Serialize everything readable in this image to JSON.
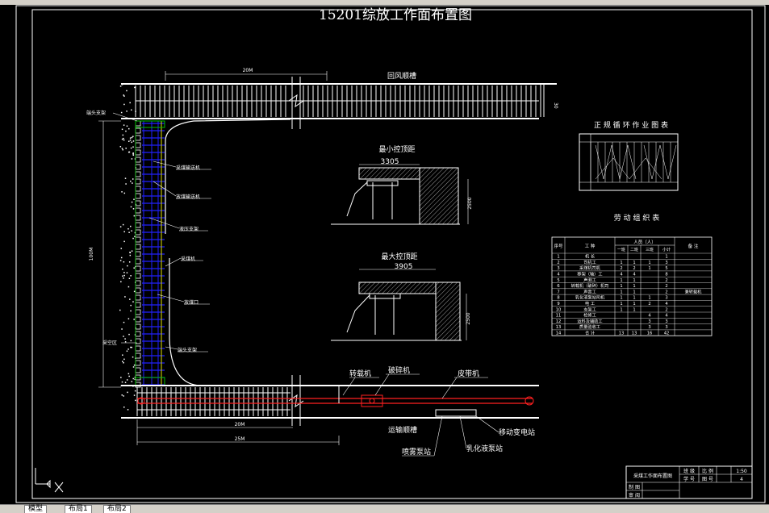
{
  "drawing": {
    "title": "15201综放工作面布置图",
    "top_roadway": "回风顺槽",
    "bottom_roadway": "运输顺槽",
    "dim_top": "20M",
    "dim_bottom_inner": "20M",
    "dim_bottom_outer": "25M",
    "dim_face": "100M",
    "dim_right_small": "30"
  },
  "face_labels": {
    "head_support_top": "端头支架",
    "goaf": "采空区",
    "conveyor_front": "采煤输送机",
    "conveyor_rear": "放煤输送机",
    "hydraulic_support": "液压支架",
    "shearer": "采煤机",
    "caving_opening": "放煤口",
    "head_support_bottom": "端头支架"
  },
  "roadway_labels": {
    "reloader": "转载机",
    "crusher": "破碎机",
    "belt_conveyor": "皮带机",
    "mobile_substation": "移动变电站",
    "emulsion_pump": "乳化液泵站",
    "spray_pump": "喷雾泵站"
  },
  "sections": {
    "min_title": "最小控顶距",
    "min_width": "3305",
    "min_height": "2500",
    "max_title": "最大控顶距",
    "max_width": "3905",
    "max_height": "2500"
  },
  "cycle_chart": {
    "title": "正 规 循 环 作 业 图 表"
  },
  "labor_table": {
    "title": "劳 动 组 织 表",
    "headers": [
      "序号",
      "工 种",
      "人员（人）",
      "备 注"
    ],
    "subheaders": [
      "一班",
      "二班",
      "三班",
      "小计"
    ],
    "rows": [
      [
        "1",
        "机 长",
        "",
        "",
        "",
        "1",
        ""
      ],
      [
        "2",
        "司机工",
        "1",
        "1",
        "1",
        "3",
        ""
      ],
      [
        "3",
        "采煤机司机",
        "2",
        "2",
        "1",
        "5",
        ""
      ],
      [
        "4",
        "移架（输）工",
        "4",
        "4",
        "",
        "8",
        ""
      ],
      [
        "5",
        "声测工",
        "1",
        "1",
        "",
        "2",
        ""
      ],
      [
        "6",
        "转载机（破碎）机司",
        "1",
        "1",
        "",
        "2",
        ""
      ],
      [
        "7",
        "声音工",
        "1",
        "1",
        "",
        "2",
        "兼转载机"
      ],
      [
        "8",
        "乳化液泵站司机",
        "1",
        "1",
        "1",
        "3",
        ""
      ],
      [
        "9",
        "电 工",
        "1",
        "1",
        "2",
        "4",
        ""
      ],
      [
        "10",
        "支架工",
        "1",
        "1",
        "",
        "2",
        ""
      ],
      [
        "11",
        "检修工",
        "",
        "",
        "4",
        "4",
        ""
      ],
      [
        "12",
        "运料及辅助工",
        "",
        "",
        "3",
        "3",
        ""
      ],
      [
        "13",
        "质量验收工",
        "",
        "",
        "3",
        "3",
        ""
      ],
      [
        "14",
        "合 计",
        "13",
        "13",
        "16",
        "42",
        ""
      ]
    ]
  },
  "title_block": {
    "name": "采煤工作面布置图",
    "cells": [
      "班 级",
      "比 例",
      "1:50",
      "学 号",
      "图 号",
      "4",
      "制 图",
      "审 阅"
    ]
  },
  "tabs": [
    "模型",
    "布局1",
    "布局2"
  ],
  "colors": {
    "background": "#000000",
    "line": "#ffffff",
    "support_blue": "#2020ff",
    "support_yellow": "#e0e000",
    "support_green": "#00c000",
    "belt_red": "#ff2020"
  }
}
